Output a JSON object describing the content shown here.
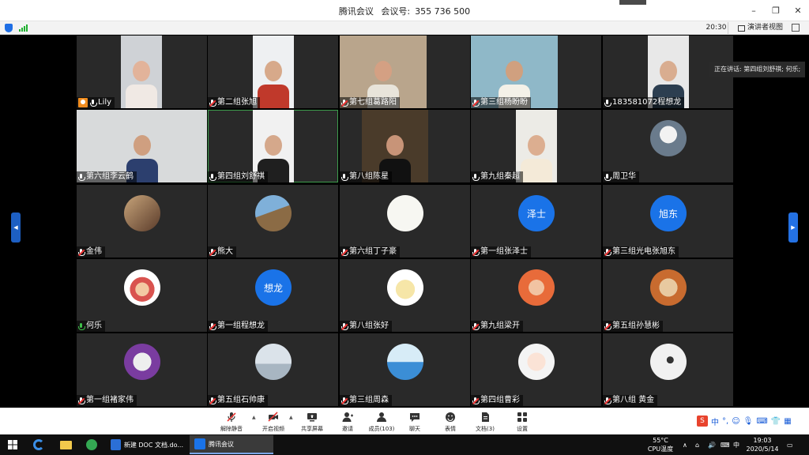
{
  "window": {
    "app_name": "腾讯会议",
    "meeting_id_label": "会议号:",
    "meeting_id": "355 736 500",
    "minimize": "–",
    "restore": "❐",
    "close": "✕"
  },
  "status": {
    "elapsed": "20:30",
    "view_label": "演讲者视图"
  },
  "speaking_banner": "正在讲话: 第四组刘舒祺; 何乐;",
  "participants": [
    {
      "name": "Lily",
      "mic": "on",
      "host": true,
      "kind": "video"
    },
    {
      "name": "第二组张旭",
      "mic": "muted",
      "kind": "video"
    },
    {
      "name": "第七组葛路阳",
      "mic": "muted",
      "kind": "video"
    },
    {
      "name": "第三组杨盼盼",
      "mic": "muted",
      "kind": "video"
    },
    {
      "name": "183581072程想龙",
      "mic": "on",
      "kind": "video"
    },
    {
      "name": "第六组李云鹤",
      "mic": "on",
      "kind": "video"
    },
    {
      "name": "第四组刘舒祺",
      "mic": "on",
      "kind": "video",
      "active": true
    },
    {
      "name": "第八组陈星",
      "mic": "on",
      "kind": "video"
    },
    {
      "name": "第九组秦超",
      "mic": "on",
      "kind": "video"
    },
    {
      "name": "周卫华",
      "mic": "on",
      "kind": "avatar",
      "avatar_icon": "astronaut-avatar-icon"
    },
    {
      "name": "金伟",
      "mic": "muted",
      "kind": "avatar",
      "avatar_icon": "photo-avatar-icon"
    },
    {
      "name": "熊大",
      "mic": "muted",
      "kind": "avatar",
      "avatar_icon": "mountain-avatar-icon"
    },
    {
      "name": "第六组丁子豪",
      "mic": "muted",
      "kind": "avatar",
      "avatar_icon": "calligraphy-avatar-icon"
    },
    {
      "name": "第一组张泽士",
      "mic": "muted",
      "kind": "text-avatar",
      "avatar_text": "泽士"
    },
    {
      "name": "第三组光电张旭东",
      "mic": "muted",
      "kind": "text-avatar",
      "avatar_text": "旭东"
    },
    {
      "name": "何乐",
      "mic": "green",
      "kind": "avatar",
      "avatar_icon": "cartoon-girl-avatar-icon"
    },
    {
      "name": "第一组程想龙",
      "mic": "muted",
      "kind": "text-avatar",
      "avatar_text": "想龙"
    },
    {
      "name": "第八组张好",
      "mic": "muted",
      "kind": "avatar",
      "avatar_icon": "cartoon-avatar-icon"
    },
    {
      "name": "第九组梁开",
      "mic": "muted",
      "kind": "avatar",
      "avatar_icon": "child-avatar-icon"
    },
    {
      "name": "第五组孙慧彬",
      "mic": "muted",
      "kind": "avatar",
      "avatar_icon": "cat-avatar-icon"
    },
    {
      "name": "第一组褚家伟",
      "mic": "muted",
      "kind": "avatar",
      "avatar_icon": "white-cat-avatar-icon"
    },
    {
      "name": "第五组石帅康",
      "mic": "muted",
      "kind": "avatar",
      "avatar_icon": "landscape-avatar-icon"
    },
    {
      "name": "第三组周森",
      "mic": "muted",
      "kind": "avatar",
      "avatar_icon": "birds-avatar-icon"
    },
    {
      "name": "第四组曹彩",
      "mic": "muted",
      "kind": "avatar",
      "avatar_icon": "anime-girl-avatar-icon"
    },
    {
      "name": "第八组 黄金",
      "mic": "muted",
      "kind": "avatar",
      "avatar_icon": "dancer-avatar-icon"
    }
  ],
  "toolbar": {
    "unmute": "解除静音",
    "start_video": "开启视频",
    "share_screen": "共享屏幕",
    "invite": "邀请",
    "members": "成员(103)",
    "chat": "聊天",
    "reactions": "表情",
    "documents": "文档(3)",
    "settings": "设置"
  },
  "ime": {
    "brand": "S",
    "lang": "中",
    "punct": "°,"
  },
  "taskbar": {
    "apps": [
      {
        "label": "新建 DOC 文档.do..."
      },
      {
        "label": "腾讯会议"
      }
    ],
    "temperature": "55°C",
    "cpu_label": "CPU温度",
    "ime_lang": "中",
    "time": "19:03",
    "date": "2020/5/14"
  },
  "colors": {
    "tile_bg": "#292929",
    "grid_bg": "#000000",
    "accent_blue": "#1a73e8",
    "host_orange": "#f08c1e",
    "active_green": "#3d9e4d"
  }
}
